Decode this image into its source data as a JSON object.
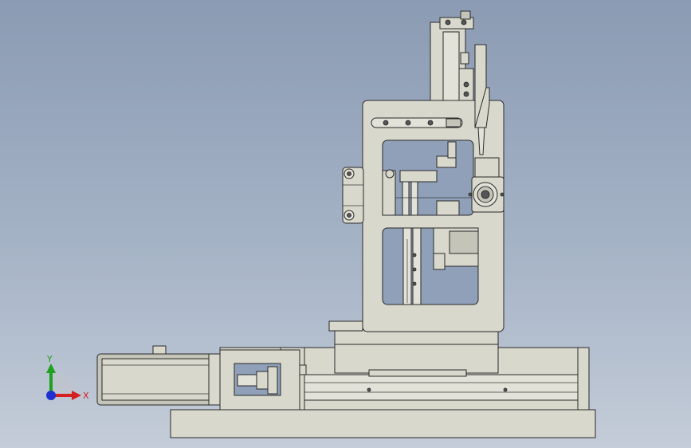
{
  "triad": {
    "x_label": "X",
    "y_label": "Y",
    "x_color": "#d42020",
    "y_color": "#20a020",
    "z_color": "#2030d0"
  },
  "colors": {
    "background_top": "#8b9bb3",
    "background_bottom": "#c4ccd8",
    "part_fill": "#d8d8cc",
    "edge": "#2a2a2a"
  }
}
